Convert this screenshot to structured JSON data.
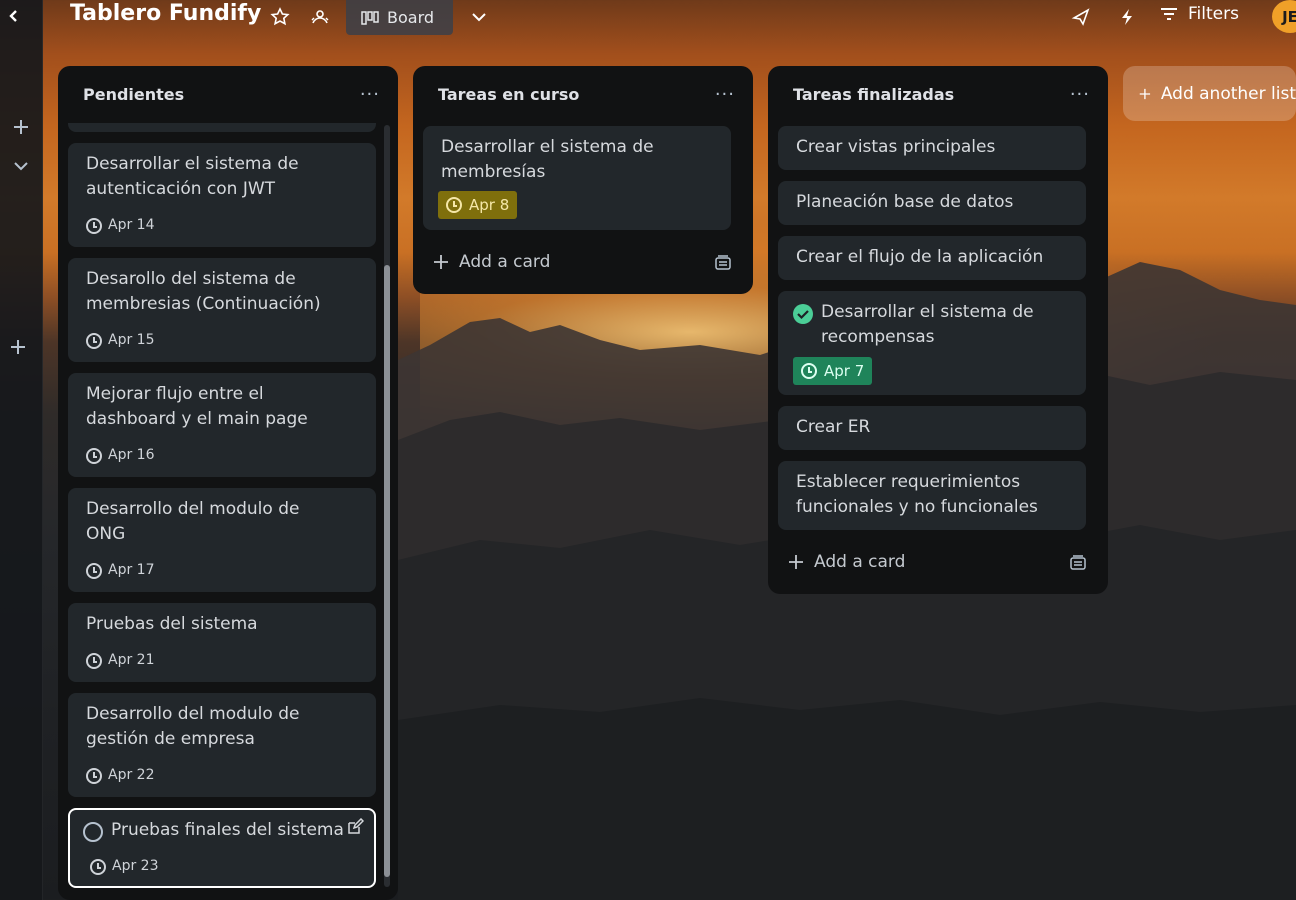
{
  "topbar": {
    "board_title": "Tablero Fundify",
    "view_label": "Board",
    "filters_label": "Filters",
    "avatar_initials": "JE"
  },
  "lists": [
    {
      "title": "Pendientes",
      "cards": [
        {
          "title": "Desarrollar el sistema de autenticación con JWT",
          "due": "Apr 14"
        },
        {
          "title": "Desarollo del sistema de membresias (Continuación)",
          "due": "Apr 15"
        },
        {
          "title": "Mejorar flujo entre el dashboard y el main page",
          "due": "Apr 16"
        },
        {
          "title": "Desarrollo del modulo de ONG",
          "due": "Apr 17"
        },
        {
          "title": "Pruebas del sistema",
          "due": "Apr 21"
        },
        {
          "title": "Desarrollo del modulo de gestión de empresa",
          "due": "Apr 22"
        },
        {
          "title": "Pruebas finales del sistema",
          "due": "Apr 23"
        }
      ]
    },
    {
      "title": "Tareas en curso",
      "cards": [
        {
          "title": "Desarrollar el sistema de membresías",
          "due": "Apr 8"
        }
      ],
      "add_card_label": "Add a card"
    },
    {
      "title": "Tareas finalizadas",
      "cards": [
        {
          "title": "Crear vistas principales"
        },
        {
          "title": "Planeación base de datos"
        },
        {
          "title": "Crear el flujo de la aplicación"
        },
        {
          "title": "Desarrollar el sistema de recompensas",
          "due": "Apr 7"
        },
        {
          "title": "Crear ER"
        },
        {
          "title": "Establecer requerimientos funcionales y no funcionales"
        }
      ],
      "add_card_label": "Add a card"
    }
  ],
  "add_list_label": "Add another list",
  "colors": {
    "due_soon": "#7f6f0c",
    "done": "#1f845a",
    "card_bg": "#22272b",
    "list_bg": "#111213"
  }
}
